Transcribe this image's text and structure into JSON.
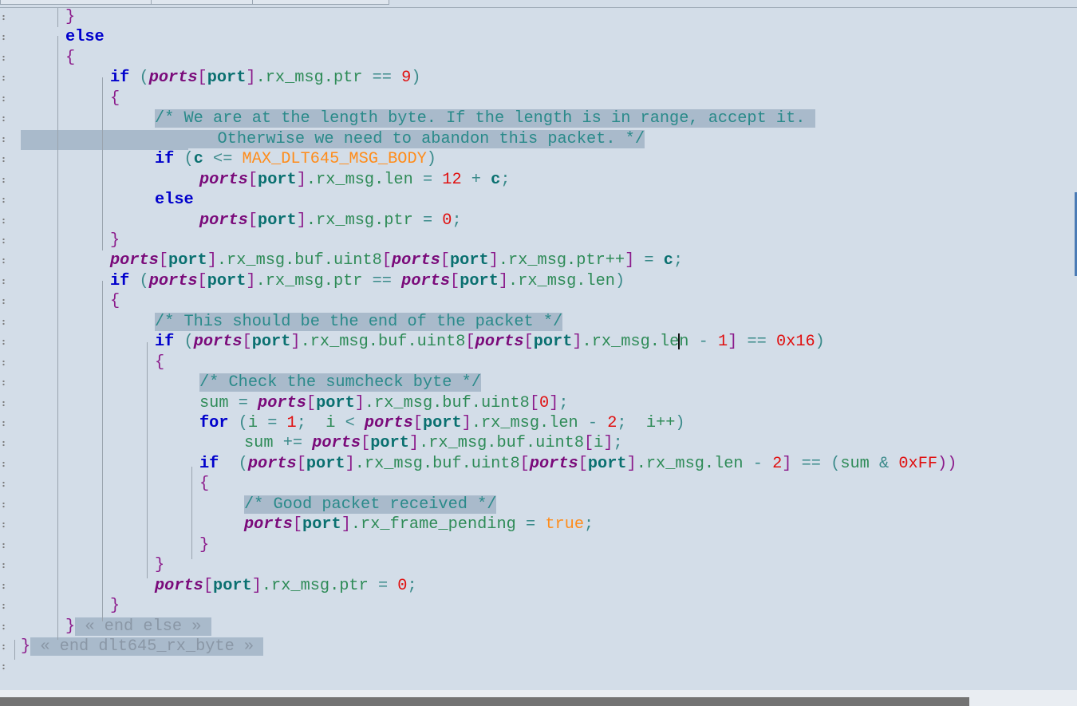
{
  "editor": {
    "lines": [
      [
        {
          "c": "br",
          "t": "}"
        }
      ],
      [
        {
          "c": "kw",
          "t": "else"
        }
      ],
      [
        {
          "c": "br",
          "t": "{"
        }
      ],
      [
        {
          "c": "kw",
          "t": "if"
        },
        {
          "c": "op",
          "t": " ("
        },
        {
          "c": "pv",
          "t": "ports"
        },
        {
          "c": "br",
          "t": "["
        },
        {
          "c": "pt",
          "t": "port"
        },
        {
          "c": "br",
          "t": "]"
        },
        {
          "c": "id",
          "t": ".rx_msg.ptr "
        },
        {
          "c": "op",
          "t": "== "
        },
        {
          "c": "num",
          "t": "9"
        },
        {
          "c": "op",
          "t": ")"
        }
      ],
      [
        {
          "c": "br",
          "t": "{"
        }
      ],
      [
        {
          "c": "cmt",
          "t": "/* We are at the length byte. If the length is in range, accept it. "
        }
      ],
      [
        {
          "c": "cmt",
          "t": "   Otherwise we need to abandon this packet. */"
        }
      ],
      [
        {
          "c": "kw",
          "t": "if"
        },
        {
          "c": "op",
          "t": " ("
        },
        {
          "c": "pt",
          "t": "c"
        },
        {
          "c": "op",
          "t": " <= "
        },
        {
          "c": "mac",
          "t": "MAX_DLT645_MSG_BODY"
        },
        {
          "c": "op",
          "t": ")"
        }
      ],
      [
        {
          "c": "pv",
          "t": "ports"
        },
        {
          "c": "br",
          "t": "["
        },
        {
          "c": "pt",
          "t": "port"
        },
        {
          "c": "br",
          "t": "]"
        },
        {
          "c": "id",
          "t": ".rx_msg.len "
        },
        {
          "c": "op",
          "t": "= "
        },
        {
          "c": "num",
          "t": "12"
        },
        {
          "c": "op",
          "t": " + "
        },
        {
          "c": "pt",
          "t": "c"
        },
        {
          "c": "op",
          "t": ";"
        }
      ],
      [
        {
          "c": "kw",
          "t": "else"
        }
      ],
      [
        {
          "c": "pv",
          "t": "ports"
        },
        {
          "c": "br",
          "t": "["
        },
        {
          "c": "pt",
          "t": "port"
        },
        {
          "c": "br",
          "t": "]"
        },
        {
          "c": "id",
          "t": ".rx_msg.ptr "
        },
        {
          "c": "op",
          "t": "= "
        },
        {
          "c": "num",
          "t": "0"
        },
        {
          "c": "op",
          "t": ";"
        }
      ],
      [
        {
          "c": "br",
          "t": "}"
        }
      ],
      [
        {
          "c": "pv",
          "t": "ports"
        },
        {
          "c": "br",
          "t": "["
        },
        {
          "c": "pt",
          "t": "port"
        },
        {
          "c": "br",
          "t": "]"
        },
        {
          "c": "id",
          "t": ".rx_msg.buf.uint8"
        },
        {
          "c": "br",
          "t": "["
        },
        {
          "c": "pv",
          "t": "ports"
        },
        {
          "c": "br",
          "t": "["
        },
        {
          "c": "pt",
          "t": "port"
        },
        {
          "c": "br",
          "t": "]"
        },
        {
          "c": "id",
          "t": ".rx_msg.ptr++"
        },
        {
          "c": "br",
          "t": "]"
        },
        {
          "c": "op",
          "t": " = "
        },
        {
          "c": "pt",
          "t": "c"
        },
        {
          "c": "op",
          "t": ";"
        }
      ],
      [
        {
          "c": "kw",
          "t": "if"
        },
        {
          "c": "op",
          "t": " ("
        },
        {
          "c": "pv",
          "t": "ports"
        },
        {
          "c": "br",
          "t": "["
        },
        {
          "c": "pt",
          "t": "port"
        },
        {
          "c": "br",
          "t": "]"
        },
        {
          "c": "id",
          "t": ".rx_msg.ptr "
        },
        {
          "c": "op",
          "t": "== "
        },
        {
          "c": "pv",
          "t": "ports"
        },
        {
          "c": "br",
          "t": "["
        },
        {
          "c": "pt",
          "t": "port"
        },
        {
          "c": "br",
          "t": "]"
        },
        {
          "c": "id",
          "t": ".rx_msg.len"
        },
        {
          "c": "op",
          "t": ")"
        }
      ],
      [
        {
          "c": "br",
          "t": "{"
        }
      ],
      [
        {
          "c": "cmt",
          "t": "/* This should be the end of the packet */"
        }
      ],
      [
        {
          "c": "kw",
          "t": "if"
        },
        {
          "c": "op",
          "t": " ("
        },
        {
          "c": "pv",
          "t": "ports"
        },
        {
          "c": "br",
          "t": "["
        },
        {
          "c": "pt",
          "t": "port"
        },
        {
          "c": "br",
          "t": "]"
        },
        {
          "c": "id",
          "t": ".rx_msg.buf.uint8"
        },
        {
          "c": "br",
          "t": "["
        },
        {
          "c": "pv",
          "t": "ports"
        },
        {
          "c": "br",
          "t": "["
        },
        {
          "c": "pt",
          "t": "port"
        },
        {
          "c": "br",
          "t": "]"
        },
        {
          "c": "id",
          "t": ".rx_msg.le"
        },
        {
          "c": "cursor",
          "t": ""
        },
        {
          "c": "id",
          "t": "n"
        },
        {
          "c": "op",
          "t": " - "
        },
        {
          "c": "num",
          "t": "1"
        },
        {
          "c": "br",
          "t": "]"
        },
        {
          "c": "op",
          "t": " == "
        },
        {
          "c": "num",
          "t": "0x16"
        },
        {
          "c": "op",
          "t": ")"
        }
      ],
      [
        {
          "c": "br",
          "t": "{"
        }
      ],
      [
        {
          "c": "cmt",
          "t": "/* Check the sumcheck byte */"
        }
      ],
      [
        {
          "c": "id",
          "t": "sum "
        },
        {
          "c": "op",
          "t": "= "
        },
        {
          "c": "pv",
          "t": "ports"
        },
        {
          "c": "br",
          "t": "["
        },
        {
          "c": "pt",
          "t": "port"
        },
        {
          "c": "br",
          "t": "]"
        },
        {
          "c": "id",
          "t": ".rx_msg.buf.uint8"
        },
        {
          "c": "br",
          "t": "["
        },
        {
          "c": "num",
          "t": "0"
        },
        {
          "c": "br",
          "t": "]"
        },
        {
          "c": "op",
          "t": ";"
        }
      ],
      [
        {
          "c": "kw",
          "t": "for"
        },
        {
          "c": "op",
          "t": " ("
        },
        {
          "c": "id",
          "t": "i "
        },
        {
          "c": "op",
          "t": "= "
        },
        {
          "c": "num",
          "t": "1"
        },
        {
          "c": "op",
          "t": ";  "
        },
        {
          "c": "id",
          "t": "i "
        },
        {
          "c": "op",
          "t": "< "
        },
        {
          "c": "pv",
          "t": "ports"
        },
        {
          "c": "br",
          "t": "["
        },
        {
          "c": "pt",
          "t": "port"
        },
        {
          "c": "br",
          "t": "]"
        },
        {
          "c": "id",
          "t": ".rx_msg.len "
        },
        {
          "c": "op",
          "t": "- "
        },
        {
          "c": "num",
          "t": "2"
        },
        {
          "c": "op",
          "t": ";  "
        },
        {
          "c": "id",
          "t": "i++"
        },
        {
          "c": "op",
          "t": ")"
        }
      ],
      [
        {
          "c": "id",
          "t": "sum "
        },
        {
          "c": "op",
          "t": "+= "
        },
        {
          "c": "pv",
          "t": "ports"
        },
        {
          "c": "br",
          "t": "["
        },
        {
          "c": "pt",
          "t": "port"
        },
        {
          "c": "br",
          "t": "]"
        },
        {
          "c": "id",
          "t": ".rx_msg.buf.uint8"
        },
        {
          "c": "br",
          "t": "["
        },
        {
          "c": "id",
          "t": "i"
        },
        {
          "c": "br",
          "t": "]"
        },
        {
          "c": "op",
          "t": ";"
        }
      ],
      [
        {
          "c": "kw",
          "t": "if"
        },
        {
          "c": "op",
          "t": "  ("
        },
        {
          "c": "pv",
          "t": "ports"
        },
        {
          "c": "br",
          "t": "["
        },
        {
          "c": "pt",
          "t": "port"
        },
        {
          "c": "br",
          "t": "]"
        },
        {
          "c": "id",
          "t": ".rx_msg.buf.uint8"
        },
        {
          "c": "br",
          "t": "["
        },
        {
          "c": "pv",
          "t": "ports"
        },
        {
          "c": "br",
          "t": "["
        },
        {
          "c": "pt",
          "t": "port"
        },
        {
          "c": "br",
          "t": "]"
        },
        {
          "c": "id",
          "t": ".rx_msg.len "
        },
        {
          "c": "op",
          "t": "- "
        },
        {
          "c": "num",
          "t": "2"
        },
        {
          "c": "br",
          "t": "]"
        },
        {
          "c": "op",
          "t": " == ("
        },
        {
          "c": "id",
          "t": "sum "
        },
        {
          "c": "op",
          "t": "& "
        },
        {
          "c": "num",
          "t": "0xFF"
        },
        {
          "c": "br",
          "t": "))"
        }
      ],
      [
        {
          "c": "br",
          "t": "{"
        }
      ],
      [
        {
          "c": "cmt",
          "t": "/* Good packet received */"
        }
      ],
      [
        {
          "c": "pv",
          "t": "ports"
        },
        {
          "c": "br",
          "t": "["
        },
        {
          "c": "pt",
          "t": "port"
        },
        {
          "c": "br",
          "t": "]"
        },
        {
          "c": "id",
          "t": ".rx_frame_pending "
        },
        {
          "c": "op",
          "t": "= "
        },
        {
          "c": "tru",
          "t": "true"
        },
        {
          "c": "op",
          "t": ";"
        }
      ],
      [
        {
          "c": "br",
          "t": "}"
        }
      ],
      [
        {
          "c": "br",
          "t": "}"
        }
      ],
      [
        {
          "c": "pv",
          "t": "ports"
        },
        {
          "c": "br",
          "t": "["
        },
        {
          "c": "pt",
          "t": "port"
        },
        {
          "c": "br",
          "t": "]"
        },
        {
          "c": "id",
          "t": ".rx_msg.ptr "
        },
        {
          "c": "op",
          "t": "= "
        },
        {
          "c": "num",
          "t": "0"
        },
        {
          "c": "op",
          "t": ";"
        }
      ],
      [
        {
          "c": "br",
          "t": "}"
        }
      ],
      [
        {
          "c": "br",
          "t": "}"
        },
        {
          "c": "fold",
          "t": " « end else » "
        }
      ],
      [
        {
          "c": "br",
          "t": "}"
        },
        {
          "c": "fold",
          "t": " « end dlt645_rx_byte » "
        }
      ],
      []
    ]
  }
}
